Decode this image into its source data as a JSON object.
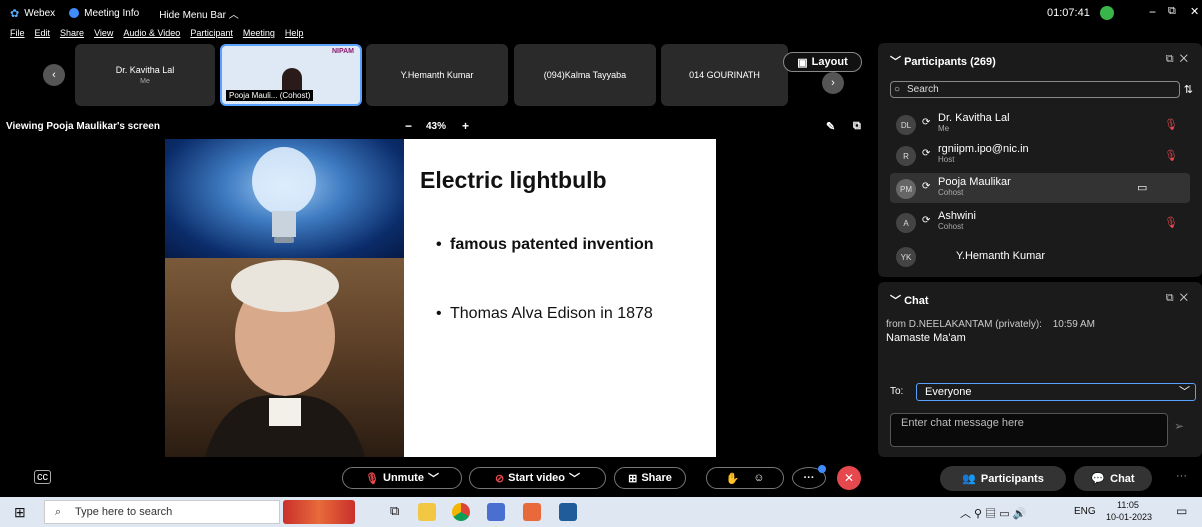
{
  "title_bar": {
    "app": "Webex",
    "meeting_info": "Meeting Info",
    "hide_menu": "Hide Menu Bar ︿",
    "time": "01:07:41",
    "min": "−",
    "restore": "⧉",
    "close": "✕"
  },
  "menu": [
    "File",
    "Edit",
    "Share",
    "View",
    "Audio & Video",
    "Participant",
    "Meeting",
    "Help"
  ],
  "thumbnails": [
    {
      "name": "Dr. Kavitha Lal",
      "sub": "Me"
    },
    {
      "name": "Pooja Mauli... (Cohost)",
      "sub": ""
    },
    {
      "name": "Y.Hemanth Kumar",
      "sub": ""
    },
    {
      "name": "(094)Kalma Tayyaba",
      "sub": ""
    },
    {
      "name": "014 GOURINATH",
      "sub": ""
    }
  ],
  "thumb_logo": "NIPAM",
  "layout_label": "Layout",
  "share_status": "Viewing Pooja Maulikar's screen",
  "zoom": {
    "minus": "−",
    "value": "43%",
    "plus": "+"
  },
  "slide": {
    "title": "Electric lightbulb",
    "bullets": [
      "famous patented invention",
      "Thomas Alva Edison in 1878"
    ]
  },
  "participants": {
    "header": "Participants (269)",
    "search_placeholder": "Search",
    "list": [
      {
        "initials": "DL",
        "name": "Dr. Kavitha Lal",
        "role": "Me"
      },
      {
        "initials": "R",
        "name": "rgniipm.ipo@nic.in",
        "role": "Host"
      },
      {
        "initials": "PM",
        "name": "Pooja Maulikar",
        "role": "Cohost"
      },
      {
        "initials": "A",
        "name": "Ashwini",
        "role": "Cohost"
      },
      {
        "initials": "YK",
        "name": "Y.Hemanth Kumar",
        "role": ""
      }
    ]
  },
  "chat": {
    "header": "Chat",
    "from": "from D.NEELAKANTAM (privately):",
    "time": "10:59 AM",
    "message": "Namaste Ma'am",
    "to_label": "To:",
    "to_value": "Everyone",
    "placeholder": "Enter chat message here"
  },
  "toolbar": {
    "unmute": "Unmute",
    "start_video": "Start video",
    "share": "Share",
    "participants": "Participants",
    "chat": "Chat",
    "more": "···"
  },
  "taskbar": {
    "search_placeholder": "Type here to search",
    "lang": "ENG",
    "time": "11:05",
    "date": "10-01-2023"
  }
}
